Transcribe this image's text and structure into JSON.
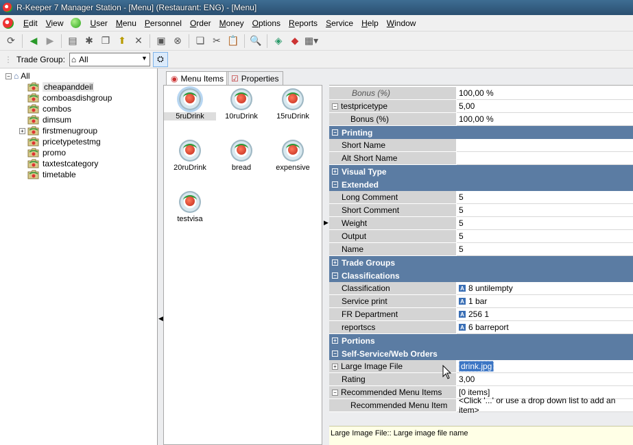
{
  "window": {
    "title": "R-Keeper 7 Manager Station - [Menu] (Restaurant: ENG) - [Menu]"
  },
  "menubar": {
    "items": [
      "Edit",
      "View",
      "User",
      "Menu",
      "Personnel",
      "Order",
      "Money",
      "Options",
      "Reports",
      "Service",
      "Help",
      "Window"
    ]
  },
  "trade_group": {
    "label": "Trade Group:",
    "value": "All"
  },
  "tree": {
    "root": "All",
    "items": [
      "cheapanddeil",
      "comboasdishgroup",
      "combos",
      "dimsum",
      "firstmenugroup",
      "pricetypetestmg",
      "promo",
      "taxtestcategory",
      "timetable"
    ]
  },
  "tabs": [
    "Menu Items",
    "Properties"
  ],
  "menu_items": [
    "5ruDrink",
    "10ruDrink",
    "15ruDrink",
    "20ruDrink",
    "bread",
    "expensive",
    "testvisa"
  ],
  "properties": [
    {
      "type": "prop",
      "key": "Bonus (%)",
      "value": "100,00 %",
      "italic": true,
      "indent": 2
    },
    {
      "type": "prop",
      "key": "testpricetype",
      "value": "5,00",
      "exp": "−",
      "indent": 1
    },
    {
      "type": "prop",
      "key": "Bonus (%)",
      "value": "100,00 %",
      "indent": 3
    },
    {
      "type": "cat",
      "key": "Printing",
      "exp": "−"
    },
    {
      "type": "prop",
      "key": "Short Name",
      "value": "",
      "indent": 1
    },
    {
      "type": "prop",
      "key": "Alt Short Name",
      "value": "",
      "indent": 1
    },
    {
      "type": "cat",
      "key": "Visual Type",
      "exp": "+"
    },
    {
      "type": "cat",
      "key": "Extended",
      "exp": "−"
    },
    {
      "type": "prop",
      "key": "Long Comment",
      "value": "5",
      "indent": 1
    },
    {
      "type": "prop",
      "key": "Short Comment",
      "value": "5",
      "indent": 1
    },
    {
      "type": "prop",
      "key": "Weight",
      "value": "5",
      "indent": 1
    },
    {
      "type": "prop",
      "key": "Output",
      "value": "5",
      "indent": 1
    },
    {
      "type": "prop",
      "key": "Name",
      "value": "5",
      "indent": 1
    },
    {
      "type": "cat",
      "key": "Trade Groups",
      "exp": "+"
    },
    {
      "type": "cat",
      "key": "Classifications",
      "exp": "−"
    },
    {
      "type": "prop",
      "key": "Classification",
      "value": "8 untilempty",
      "badge": "A",
      "indent": 1
    },
    {
      "type": "prop",
      "key": "Service print",
      "value": "1 bar",
      "badge": "A",
      "indent": 1
    },
    {
      "type": "prop",
      "key": "FR Department",
      "value": "256 1",
      "badge": "A",
      "indent": 1
    },
    {
      "type": "prop",
      "key": "reportscs",
      "value": "6 barreport",
      "badge": "A",
      "indent": 1
    },
    {
      "type": "cat",
      "key": "Portions",
      "exp": "+"
    },
    {
      "type": "cat",
      "key": "Self-Service/Web Orders",
      "exp": "−"
    },
    {
      "type": "prop",
      "key": "Large Image File",
      "value": "drink.jpg",
      "exp": "+",
      "selected": true,
      "indent": 1
    },
    {
      "type": "prop",
      "key": "Rating",
      "value": "3,00",
      "indent": 1
    },
    {
      "type": "prop",
      "key": "Recommended Menu Items",
      "value": "[0 items]",
      "exp": "−",
      "indent": 1
    },
    {
      "type": "prop",
      "key": "Recommended Menu Item",
      "value": "<Click '...' or use a drop down list to add an item>",
      "indent": 3
    }
  ],
  "help_text": "Large Image File:: Large image file name"
}
